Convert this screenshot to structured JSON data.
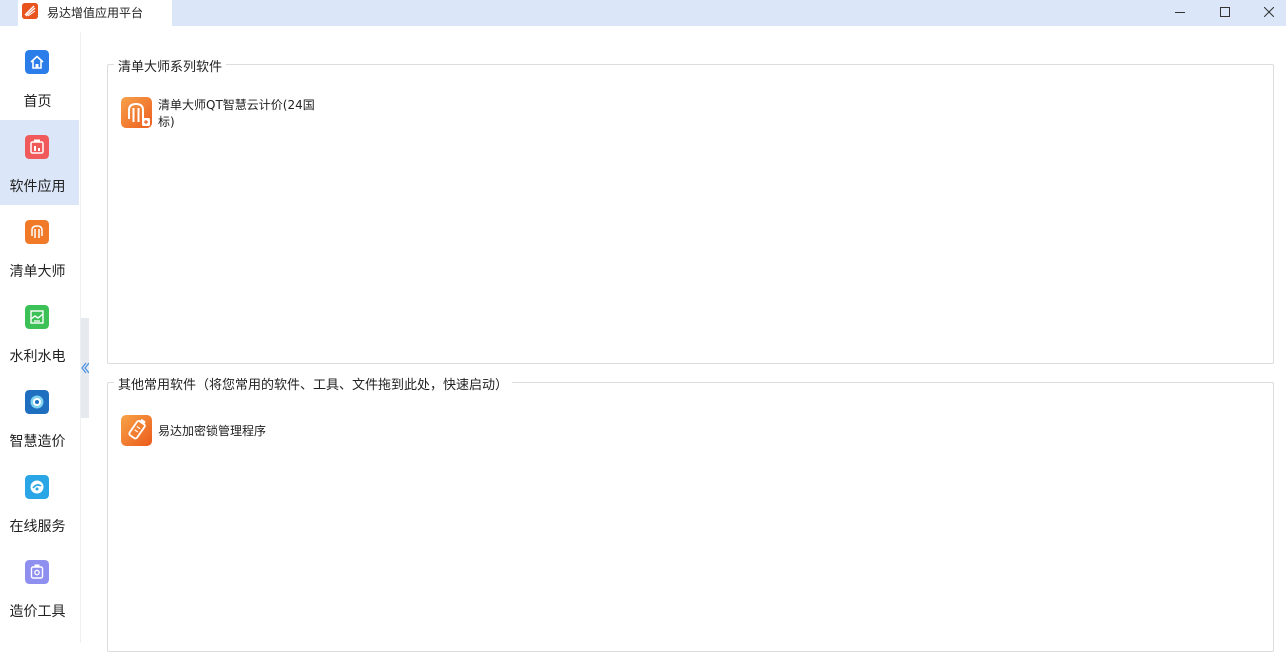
{
  "window": {
    "title": "易达增值应用平台",
    "controls": [
      "minimize-icon",
      "maximize-icon",
      "close-icon"
    ]
  },
  "sidebar": {
    "items": [
      {
        "label": "首页",
        "icon": "home-icon",
        "color": "#2b7de9"
      },
      {
        "label": "软件应用",
        "icon": "software-app-icon",
        "color": "#f05a5a",
        "active": true
      },
      {
        "label": "清单大师",
        "icon": "qingdan-master-icon",
        "color": "#f07a28"
      },
      {
        "label": "水利水电",
        "icon": "water-conservancy-icon",
        "color": "#3cc156"
      },
      {
        "label": "智慧造价",
        "icon": "smart-cost-icon",
        "color": "#1e6fbf"
      },
      {
        "label": "在线服务",
        "icon": "online-service-icon",
        "color": "#2aa6e6"
      },
      {
        "label": "造价工具",
        "icon": "cost-tool-icon",
        "color": "#8f8ff0"
      }
    ]
  },
  "groups": [
    {
      "title": "清单大师系列软件",
      "apps": [
        {
          "name": "清单大师QT智慧云计价(24国标)",
          "icon": "qingdan-qt-app-icon",
          "color": "#f07a28"
        }
      ]
    },
    {
      "title": "其他常用软件（将您常用的软件、工具、文件拖到此处，快速启动）",
      "apps": [
        {
          "name": "易达加密锁管理程序",
          "icon": "dongle-manager-app-icon",
          "color": "#f07a28"
        }
      ]
    }
  ]
}
